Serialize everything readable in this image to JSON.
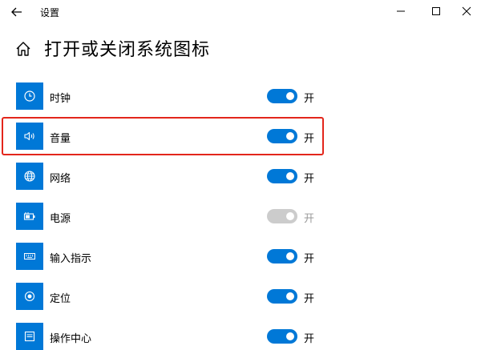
{
  "window": {
    "title": "设置"
  },
  "page": {
    "title": "打开或关闭系统图标"
  },
  "accent_color": "#0078d7",
  "highlight_color": "#e3261b",
  "items": [
    {
      "label": "时钟",
      "icon": "clock-icon",
      "state": "开",
      "enabled": true
    },
    {
      "label": "音量",
      "icon": "volume-icon",
      "state": "开",
      "enabled": true
    },
    {
      "label": "网络",
      "icon": "network-globe-icon",
      "state": "开",
      "enabled": true
    },
    {
      "label": "电源",
      "icon": "battery-power-icon",
      "state": "开",
      "enabled": false
    },
    {
      "label": "输入指示",
      "icon": "keyboard-icon",
      "state": "开",
      "enabled": true
    },
    {
      "label": "定位",
      "icon": "location-icon",
      "state": "开",
      "enabled": true
    },
    {
      "label": "操作中心",
      "icon": "action-center-icon",
      "state": "开",
      "enabled": true
    }
  ]
}
